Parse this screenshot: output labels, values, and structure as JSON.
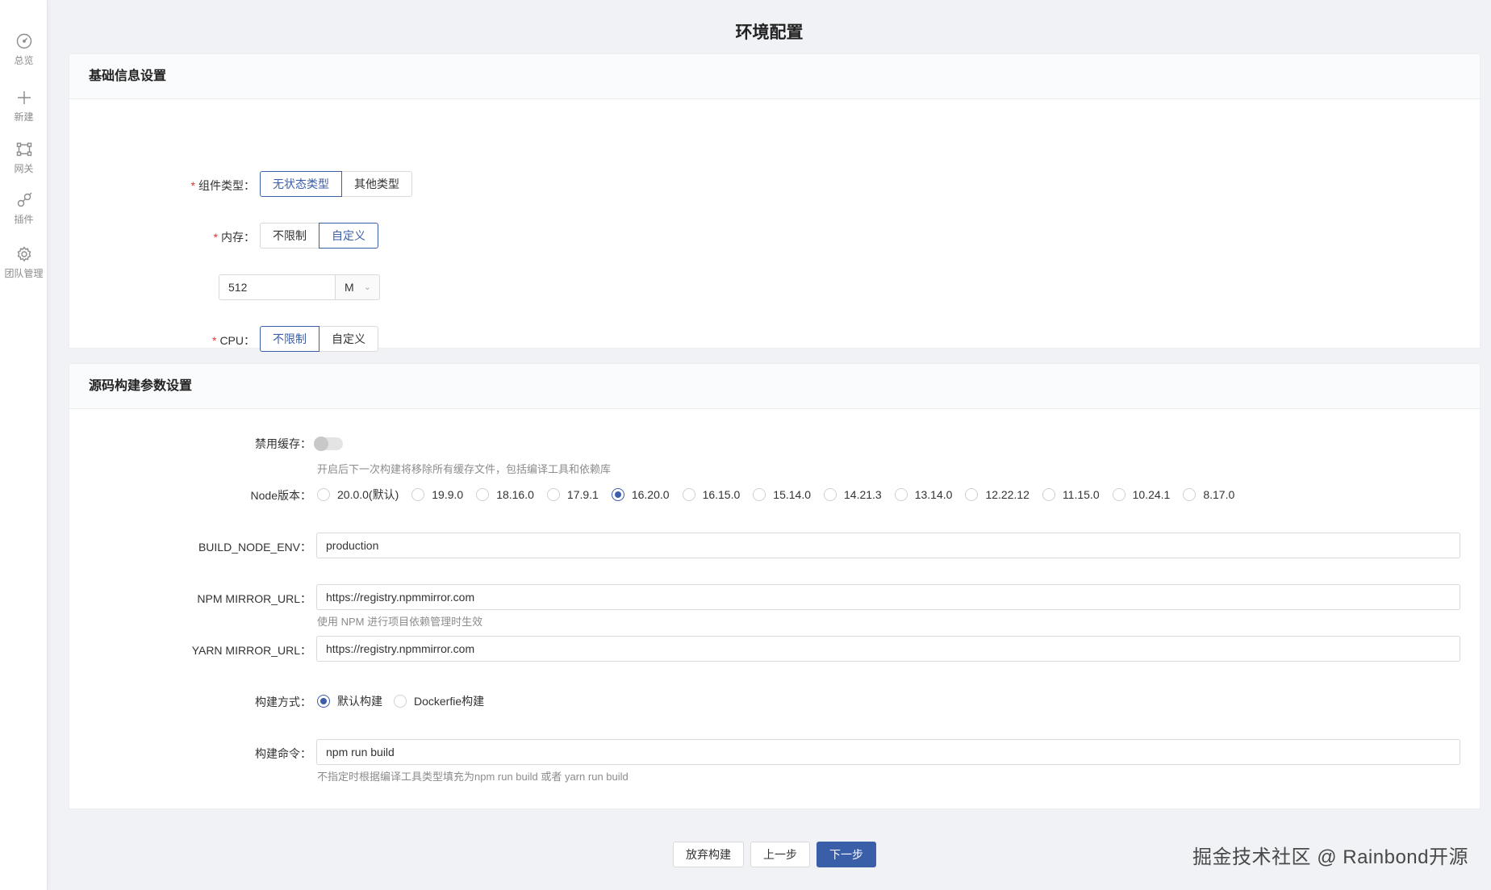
{
  "sidebar": {
    "items": [
      {
        "icon": "dashboard-icon",
        "label": "总览"
      },
      {
        "icon": "plus-icon",
        "label": "新建"
      },
      {
        "icon": "gateway-icon",
        "label": "网关"
      },
      {
        "icon": "plugin-icon",
        "label": "插件"
      },
      {
        "icon": "gear-icon",
        "label": "团队管理"
      }
    ]
  },
  "page": {
    "title": "环境配置"
  },
  "basic": {
    "title": "基础信息设置",
    "component_type": {
      "label": "组件类型",
      "options": [
        "无状态类型",
        "其他类型"
      ],
      "selected": "无状态类型"
    },
    "memory": {
      "label": "内存",
      "options": [
        "不限制",
        "自定义"
      ],
      "selected": "自定义",
      "value": "512",
      "unit": "M"
    },
    "cpu": {
      "label": "CPU",
      "options": [
        "不限制",
        "自定义"
      ],
      "selected": "不限制"
    }
  },
  "build": {
    "title": "源码构建参数设置",
    "disable_cache": {
      "label": "禁用缓存",
      "enabled": false,
      "hint": "开启后下一次构建将移除所有缓存文件，包括编译工具和依赖库"
    },
    "node_version": {
      "label": "Node版本",
      "options": [
        "20.0.0(默认)",
        "19.9.0",
        "18.16.0",
        "17.9.1",
        "16.20.0",
        "16.15.0",
        "15.14.0",
        "14.21.3",
        "13.14.0",
        "12.22.12",
        "11.15.0",
        "10.24.1",
        "8.17.0"
      ],
      "selected": "16.20.0"
    },
    "build_node_env": {
      "label": "BUILD_NODE_ENV",
      "value": "production"
    },
    "npm_mirror": {
      "label": "NPM MIRROR_URL",
      "value": "https://registry.npmmirror.com",
      "hint": "使用 NPM 进行项目依赖管理时生效"
    },
    "yarn_mirror": {
      "label": "YARN MIRROR_URL",
      "value": "https://registry.npmmirror.com"
    },
    "build_method": {
      "label": "构建方式",
      "options": [
        "默认构建",
        "Dockerfie构建"
      ],
      "selected": "默认构建"
    },
    "build_command": {
      "label": "构建命令",
      "value": "npm run build",
      "hint": "不指定时根据编译工具类型填充为npm run build 或者 yarn run build"
    }
  },
  "footer": {
    "abandon": "放弃构建",
    "prev": "上一步",
    "next": "下一步"
  },
  "watermark": "掘金技术社区 @ Rainbond开源",
  "colors": {
    "accent": "#3b5ea8",
    "required": "#e0352b"
  }
}
